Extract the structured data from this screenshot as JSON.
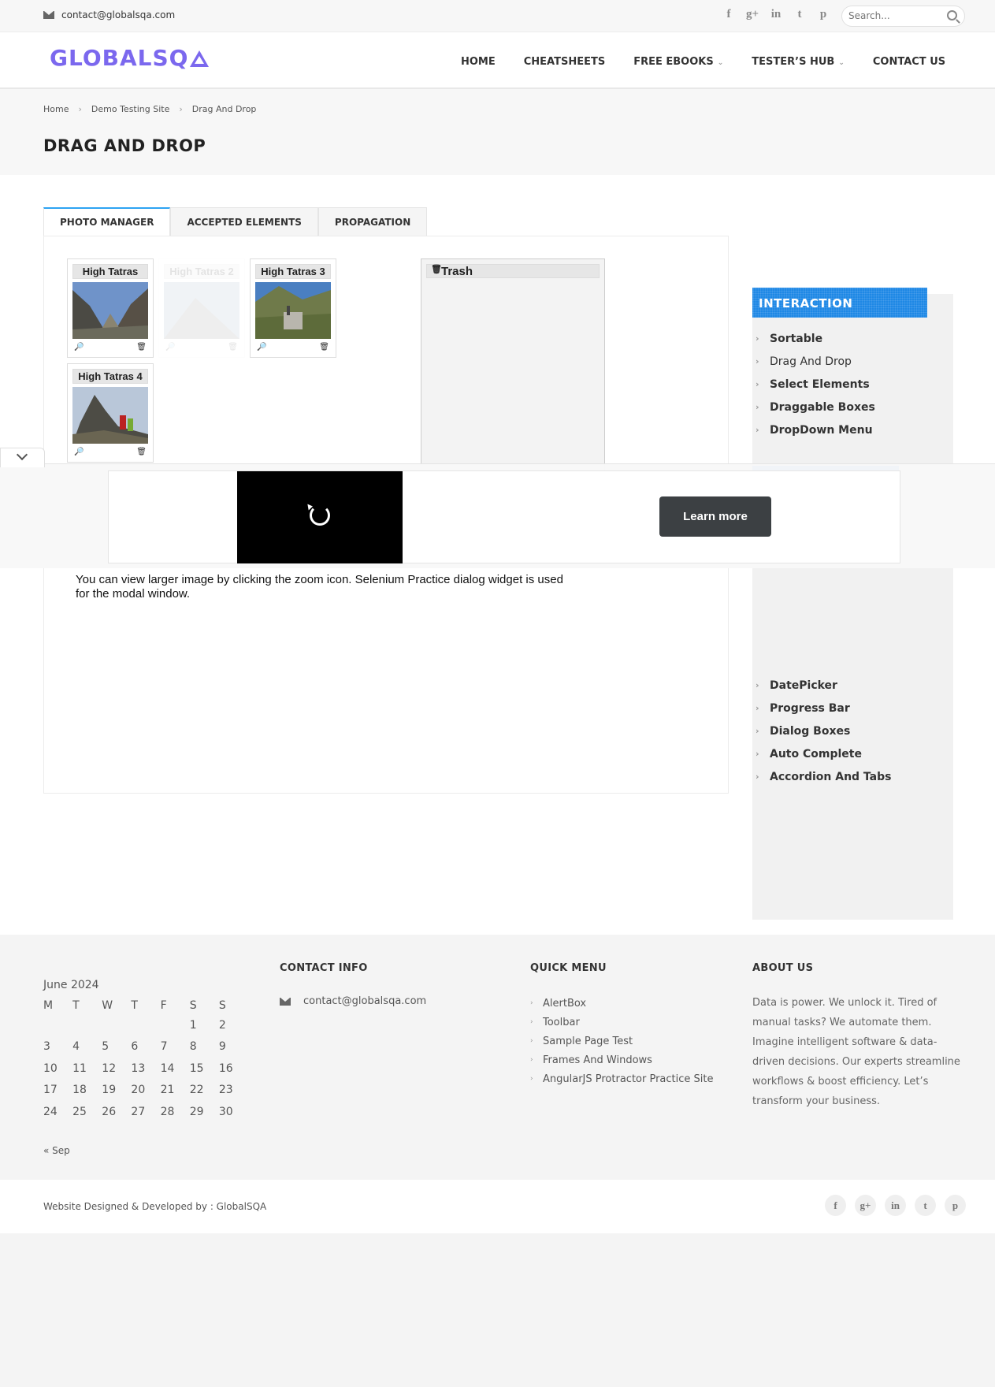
{
  "topbar": {
    "email": "contact@globalsqa.com",
    "social": [
      "f",
      "g+",
      "in",
      "t",
      "p"
    ],
    "search_placeholder": "Search..."
  },
  "header": {
    "logo_text": "GLOBALSQ",
    "nav": [
      {
        "label": "HOME",
        "dropdown": false
      },
      {
        "label": "CHEATSHEETS",
        "dropdown": false
      },
      {
        "label": "FREE EBOOKS",
        "dropdown": true
      },
      {
        "label": "TESTER’S HUB",
        "dropdown": true
      },
      {
        "label": "CONTACT US",
        "dropdown": false
      }
    ]
  },
  "breadcrumb": [
    "Home",
    "Demo Testing Site",
    "Drag And Drop"
  ],
  "page_title": "DRAG AND DROP",
  "tabs": [
    "PHOTO MANAGER",
    "ACCEPTED ELEMENTS",
    "PROPAGATION"
  ],
  "gallery": [
    {
      "title": "High Tatras",
      "state": "normal"
    },
    {
      "title": "High Tatras 2",
      "state": "dragging"
    },
    {
      "title": "High Tatras 3",
      "state": "normal"
    },
    {
      "title": "High Tatras 4",
      "state": "normal"
    }
  ],
  "trash_title": "Trash",
  "description": "You can view larger image by clicking the zoom icon. Selenium Practice dialog widget is used for the modal window.",
  "sidebar": {
    "heading": "INTERACTION",
    "items": [
      "Sortable",
      "Drag And Drop",
      "Select Elements",
      "Draggable Boxes",
      "DropDown Menu"
    ],
    "items2": [
      "DatePicker",
      "Progress Bar",
      "Dialog Boxes",
      "Auto Complete",
      "Accordion And Tabs"
    ]
  },
  "ad": {
    "cta": "Learn more"
  },
  "footer": {
    "calendar": {
      "caption": "June 2024",
      "days": [
        "M",
        "T",
        "W",
        "T",
        "F",
        "S",
        "S"
      ],
      "weeks": [
        [
          "",
          "",
          "",
          "",
          "",
          "1",
          "2"
        ],
        [
          "3",
          "4",
          "5",
          "6",
          "7",
          "8",
          "9"
        ],
        [
          "10",
          "11",
          "12",
          "13",
          "14",
          "15",
          "16"
        ],
        [
          "17",
          "18",
          "19",
          "20",
          "21",
          "22",
          "23"
        ],
        [
          "24",
          "25",
          "26",
          "27",
          "28",
          "29",
          "30"
        ]
      ],
      "prev": "« Sep"
    },
    "contact_heading": "CONTACT INFO",
    "contact_email": "contact@globalsqa.com",
    "quick_heading": "QUICK MENU",
    "quick_items": [
      "AlertBox",
      "Toolbar",
      "Sample Page Test",
      "Frames And Windows",
      "AngularJS Protractor Practice Site"
    ],
    "about_heading": "ABOUT US",
    "about_text": "Data is power. We unlock it. Tired of manual tasks? We automate them. Imagine intelligent software & data-driven decisions. Our experts streamline workflows & boost efficiency. Let’s transform your business."
  },
  "bottom": {
    "credit": "Website Designed & Developed by : GlobalSQA",
    "social": [
      "f",
      "g+",
      "in",
      "t",
      "p"
    ]
  }
}
